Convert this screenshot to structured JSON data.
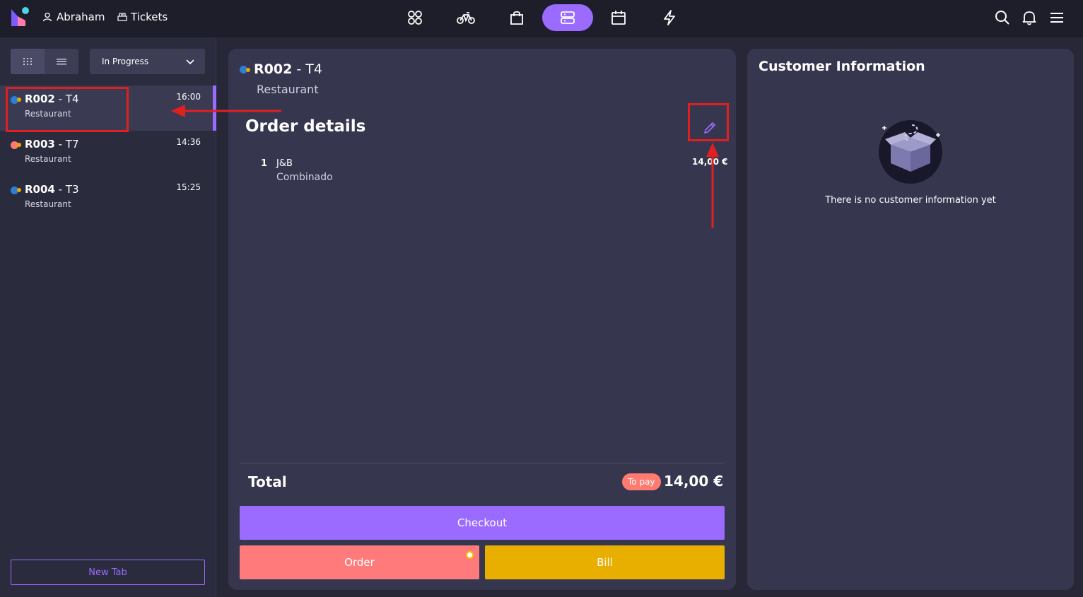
{
  "topbar": {
    "user_name": "Abraham",
    "tickets_label": "Tickets",
    "nav_icons": [
      "grid-icon",
      "bicycle-icon",
      "shopping-bag-icon",
      "server-icon",
      "calendar-icon",
      "lightning-icon"
    ],
    "active_nav": "server-icon",
    "right_icons": [
      "search-icon",
      "bell-icon",
      "menu-icon"
    ]
  },
  "sidebar": {
    "filter_value": "In Progress",
    "tabs": [
      {
        "code": "R002",
        "table": "T4",
        "venue": "Restaurant",
        "time": "16:00",
        "dot_color": "#2d7fd6",
        "selected": true
      },
      {
        "code": "R003",
        "table": "T7",
        "venue": "Restaurant",
        "time": "14:36",
        "dot_color": "#ff7b72",
        "selected": false
      },
      {
        "code": "R004",
        "table": "T3",
        "venue": "Restaurant",
        "time": "15:25",
        "dot_color": "#2d7fd6",
        "selected": false
      }
    ],
    "new_tab_label": "New Tab"
  },
  "order": {
    "code": "R002",
    "table": "T4",
    "venue": "Restaurant",
    "title": "Order details",
    "items": [
      {
        "qty": "1",
        "name": "J&B",
        "modifier": "Combinado",
        "price": "14,00 €"
      }
    ],
    "total_label": "Total",
    "to_pay_label": "To pay",
    "total_amount": "14,00 €",
    "checkout_label": "Checkout",
    "order_label": "Order",
    "bill_label": "Bill"
  },
  "customer": {
    "title": "Customer Information",
    "empty_text": "There is no customer information yet"
  },
  "colors": {
    "accent": "#9b6bff",
    "order": "#ff7b7b",
    "bill": "#e8ae00",
    "annotation": "#e02020"
  }
}
